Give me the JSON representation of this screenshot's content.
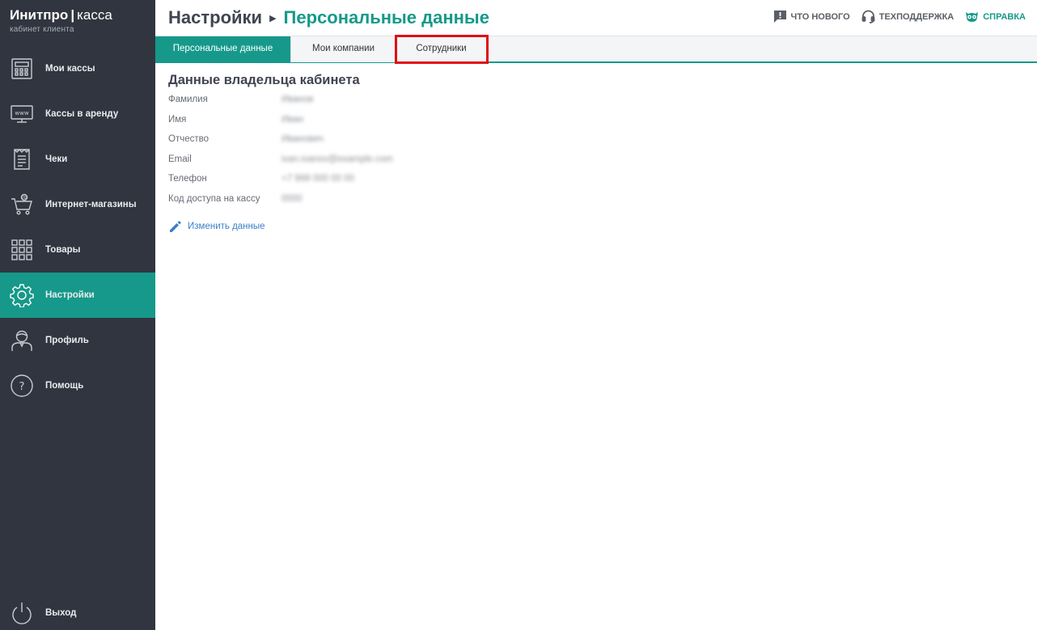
{
  "app": {
    "logo_brand": "Инитпро",
    "logo_separator": "|",
    "logo_product": "касса",
    "logo_subtitle": "кабинет клиента"
  },
  "sidebar": {
    "items": [
      {
        "label": "Мои кассы",
        "icon": "cash-register-icon"
      },
      {
        "label": "Кассы в аренду",
        "icon": "www-monitor-icon"
      },
      {
        "label": "Чеки",
        "icon": "receipt-icon"
      },
      {
        "label": "Интернет-магазины",
        "icon": "shopping-cart-icon"
      },
      {
        "label": "Товары",
        "icon": "grid-icon"
      },
      {
        "label": "Настройки",
        "icon": "gear-icon",
        "active": true
      },
      {
        "label": "Профиль",
        "icon": "user-icon"
      },
      {
        "label": "Помощь",
        "icon": "help-circle-icon"
      }
    ],
    "logout": {
      "label": "Выход",
      "icon": "power-icon"
    }
  },
  "header": {
    "breadcrumb_parent": "Настройки",
    "breadcrumb_separator": "›",
    "breadcrumb_current": "Персональные данные",
    "links": [
      {
        "label": "ЧТО НОВОГО",
        "icon": "news-icon"
      },
      {
        "label": "ТЕХПОДДЕРЖКА",
        "icon": "headset-icon"
      },
      {
        "label": "СПРАВКА",
        "icon": "owl-icon"
      }
    ]
  },
  "tabs": [
    {
      "label": "Персональные данные",
      "active": true
    },
    {
      "label": "Мои компании",
      "active": false
    },
    {
      "label": "Сотрудники",
      "active": false,
      "highlighted": true
    }
  ],
  "owner": {
    "title": "Данные владельца кабинета",
    "fields": [
      {
        "label": "Фамилия",
        "value": "Иванов"
      },
      {
        "label": "Имя",
        "value": "Иван"
      },
      {
        "label": "Отчество",
        "value": "Иванович"
      },
      {
        "label": "Email",
        "value": "ivan.ivanov@example.com"
      },
      {
        "label": "Телефон",
        "value": "+7 999 000 00 00"
      },
      {
        "label": "Код доступа на кассу",
        "value": "0000"
      }
    ],
    "edit_label": "Изменить данные"
  },
  "colors": {
    "accent": "#16998a",
    "sidebar_bg": "#31353f",
    "highlight": "#e10f14",
    "link": "#3d7fc9"
  }
}
